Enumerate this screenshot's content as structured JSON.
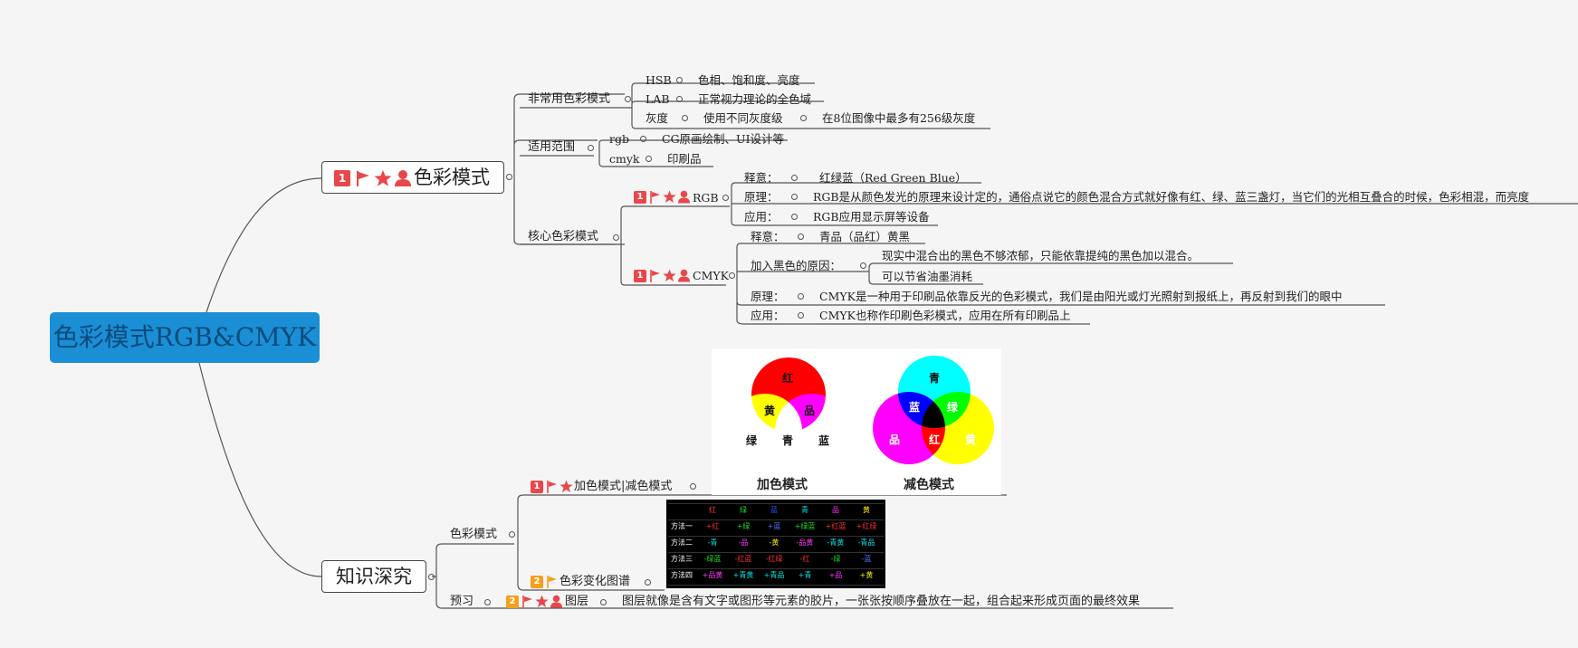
{
  "root": {
    "label": "色彩模式RGB&CMYK"
  },
  "colors": {
    "root_fill": "#1a8fd6",
    "marker_red": "#e8474b",
    "marker_orange": "#f4a01c",
    "line": "#555555"
  },
  "topic1": {
    "label": "色彩模式",
    "priority": "1",
    "uncommon": {
      "label": "非常用色彩模式",
      "items": [
        {
          "key": "HSB",
          "value": "色相、饱和度、亮度"
        },
        {
          "key": "LAB",
          "value": "正常视力理论的全色域"
        },
        {
          "key": "灰度",
          "value": "使用不同灰度级",
          "extra": "在8位图像中最多有256级灰度"
        }
      ]
    },
    "scope": {
      "label": "适用范围",
      "items": [
        {
          "key": "rgb",
          "value": "CG原画绘制、UI设计等"
        },
        {
          "key": "cmyk",
          "value": "印刷品"
        }
      ]
    },
    "core": {
      "label": "核心色彩模式",
      "rgb": {
        "label": "RGB",
        "priority": "1",
        "items": [
          {
            "key": "释意：",
            "value": "红绿蓝（Red Green Blue）"
          },
          {
            "key": "原理：",
            "value": "RGB是从颜色发光的原理来设计定的，通俗点说它的颜色混合方式就好像有红、绿、蓝三盏灯，当它们的光相互叠合的时候，色彩相混，而亮度"
          },
          {
            "key": "应用：",
            "value": "RGB应用显示屏等设备"
          }
        ]
      },
      "cmyk": {
        "label": "CMYK",
        "priority": "1",
        "items": [
          {
            "key": "释意：",
            "value": "青品（品红）黄黑"
          },
          {
            "key": "加入黑色的原因：",
            "reasons": [
              "现实中混合出的黑色不够浓郁，只能依靠提纯的黑色加以混合。",
              "可以节省油墨消耗"
            ]
          },
          {
            "key": "原理：",
            "value": "CMYK是一种用于印刷品依靠反光的色彩模式，我们是由阳光或灯光照射到报纸上，再反射到我们的眼中"
          },
          {
            "key": "应用：",
            "value": "CMYK也称作印刷色彩模式，应用在所有印刷品上"
          }
        ]
      }
    }
  },
  "topic2": {
    "label": "知识深究",
    "colormode": {
      "label": "色彩模式",
      "addsub": {
        "label": "加色模式|减色模式",
        "priority": "1",
        "image": {
          "additive_caption": "加色模式",
          "subtractive_caption": "减色模式",
          "additive_labels": [
            "红",
            "黄",
            "品",
            "绿",
            "青",
            "蓝"
          ],
          "subtractive_labels": [
            "青",
            "蓝",
            "绿",
            "品",
            "红",
            "黄"
          ]
        }
      },
      "chart": {
        "label": "色彩变化图谱",
        "priority": "2",
        "table": {
          "headers": [
            "红",
            "绿",
            "蓝",
            "青",
            "品",
            "黄"
          ],
          "rows": [
            {
              "name": "方法一",
              "cells": [
                "+红",
                "+绿",
                "+蓝",
                "+绿蓝",
                "+红蓝",
                "+红绿"
              ]
            },
            {
              "name": "方法二",
              "cells": [
                "-青",
                "-品",
                "-黄",
                "-品黄",
                "-青黄",
                "-青品"
              ]
            },
            {
              "name": "方法三",
              "cells": [
                "-绿蓝",
                "-红蓝",
                "-红绿",
                "-红",
                "-绿",
                "-蓝"
              ]
            },
            {
              "name": "方法四",
              "cells": [
                "+品黄",
                "+青黄",
                "+青品",
                "+青",
                "+品",
                "+黄"
              ]
            }
          ]
        }
      }
    },
    "preview": {
      "label": "预习",
      "layer": {
        "label": "图层",
        "priority": "2",
        "value": "图层就像是含有文字或图形等元素的胶片，一张张按顺序叠放在一起，组合起来形成页面的最终效果"
      }
    }
  }
}
